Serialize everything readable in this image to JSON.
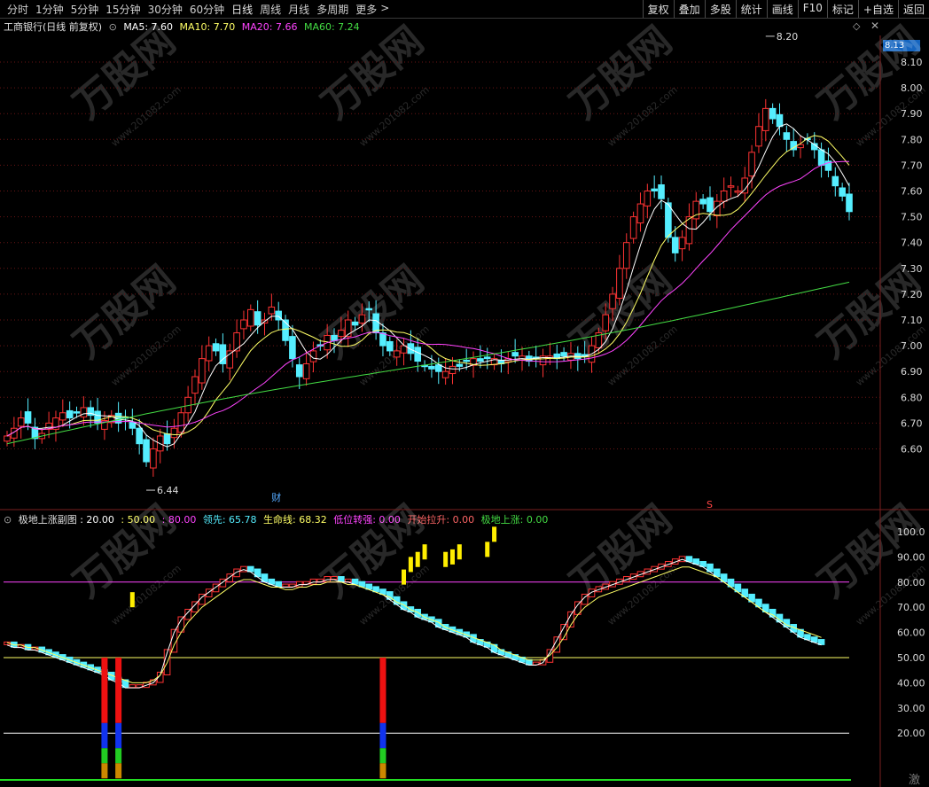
{
  "toolbar": {
    "periods": [
      "分时",
      "1分钟",
      "5分钟",
      "15分钟",
      "30分钟",
      "60分钟",
      "日线",
      "周线",
      "月线",
      "多周期",
      "更多"
    ],
    "active_period": "日线",
    "more_arrow": ">",
    "buttons": [
      "复权",
      "叠加",
      "多股",
      "统计",
      "画线",
      "F10",
      "标记",
      "+自选",
      "返回"
    ]
  },
  "main_legend": {
    "title": "工商银行(日线 前复权)",
    "ma5": "MA5: 7.60",
    "ma10": "MA10: 7.70",
    "ma20": "MA20: 7.66",
    "ma60": "MA60: 7.24"
  },
  "sub_legend": {
    "title": "极地上涨副图",
    "v1": ": 20.00",
    "v2": ": 50.00",
    "v3": ": 80.00",
    "lead": "领先: 65.78",
    "life": "生命线: 68.32",
    "low": "低位转强: 0.00",
    "start": "开始拉升: 0.00",
    "rise": "极地上涨: 0.00"
  },
  "colors": {
    "ma5": "#ffffff",
    "ma10": "#ffff66",
    "ma20": "#ff44ff",
    "ma60": "#44dd44",
    "up": "#ff3333",
    "down": "#55eeff"
  },
  "markers": {
    "high_label": "8.20",
    "low_label": "6.44",
    "last_price": "8.13",
    "event_cai": "财",
    "event_s": "S",
    "watermark": "万股网",
    "watermark_url": "www.201082.com",
    "corner_text": "激"
  },
  "chart_data": [
    {
      "type": "candlestick",
      "title": "工商银行(日线 前复权)",
      "ylim": [
        6.44,
        8.2
      ],
      "yticks": [
        "8.10",
        "8.00",
        "7.90",
        "7.80",
        "7.70",
        "7.60",
        "7.50",
        "7.40",
        "7.30",
        "7.20",
        "7.10",
        "7.00",
        "6.90",
        "6.80",
        "6.70",
        "6.60"
      ],
      "close": [
        6.65,
        6.68,
        6.72,
        6.7,
        6.64,
        6.66,
        6.7,
        6.72,
        6.74,
        6.72,
        6.74,
        6.76,
        6.73,
        6.7,
        6.71,
        6.73,
        6.7,
        6.72,
        6.68,
        6.62,
        6.55,
        6.6,
        6.65,
        6.62,
        6.68,
        6.74,
        6.8,
        6.88,
        6.95,
        7.0,
        6.98,
        6.93,
        6.98,
        7.05,
        7.1,
        7.14,
        7.08,
        7.1,
        7.15,
        7.1,
        7.02,
        6.95,
        6.88,
        6.93,
        6.98,
        7.0,
        7.04,
        7.02,
        7.06,
        7.1,
        7.08,
        7.12,
        7.14,
        7.05,
        7.0,
        6.98,
        6.98,
        7.0,
        6.97,
        6.94,
        6.92,
        6.91,
        6.9,
        6.9,
        6.92,
        6.92,
        6.94,
        6.95,
        6.94,
        6.95,
        6.95,
        6.93,
        6.95,
        6.96,
        6.96,
        6.94,
        6.95,
        6.96,
        6.96,
        6.95,
        6.96,
        6.97,
        6.95,
        6.96,
        7.0,
        7.05,
        7.12,
        7.2,
        7.3,
        7.4,
        7.5,
        7.55,
        7.6,
        7.6,
        7.57,
        7.42,
        7.36,
        7.42,
        7.5,
        7.56,
        7.55,
        7.52,
        7.56,
        7.6,
        7.62,
        7.6,
        7.65,
        7.75,
        7.85,
        7.92,
        7.88,
        7.85,
        7.8,
        7.76,
        7.78,
        7.8,
        7.76,
        7.7,
        7.68,
        7.62,
        7.58,
        7.52
      ],
      "ma_last": {
        "ma5": 7.6,
        "ma10": 7.7,
        "ma20": 7.66,
        "ma60": 7.24
      }
    },
    {
      "type": "indicator",
      "title": "极地上涨副图",
      "ylim": [
        0,
        100
      ],
      "yticks": [
        "100.0",
        "90.00",
        "80.00",
        "70.00",
        "60.00",
        "50.00",
        "40.00",
        "30.00",
        "20.00"
      ],
      "hlines": [
        20,
        50,
        80
      ],
      "lead": [
        55,
        54,
        54,
        53,
        53,
        52,
        51,
        50,
        49,
        48,
        47,
        46,
        45,
        44,
        43,
        41,
        40,
        38,
        38,
        38,
        39,
        40,
        43,
        52,
        60,
        65,
        68,
        71,
        74,
        76,
        78,
        80,
        82,
        84,
        85,
        84,
        82,
        80,
        79,
        78,
        78,
        78,
        79,
        79,
        80,
        80,
        81,
        81,
        80,
        80,
        79,
        78,
        77,
        76,
        75,
        73,
        71,
        69,
        68,
        66,
        65,
        64,
        62,
        61,
        60,
        59,
        58,
        56,
        55,
        54,
        52,
        51,
        50,
        49,
        48,
        47,
        47,
        48,
        52,
        57,
        62,
        67,
        71,
        74,
        76,
        77,
        78,
        79,
        80,
        81,
        82,
        83,
        84,
        85,
        86,
        87,
        88,
        89,
        88,
        87,
        86,
        84,
        82,
        80,
        78,
        76,
        74,
        72,
        70,
        68,
        66,
        64,
        62,
        60,
        58,
        57,
        56,
        55
      ],
      "life": [
        56,
        55,
        55,
        54,
        54,
        53,
        52,
        51,
        50,
        49,
        48,
        47,
        46,
        45,
        44,
        43,
        42,
        41,
        40,
        40,
        40,
        41,
        43,
        48,
        55,
        60,
        64,
        67,
        70,
        72,
        74,
        76,
        78,
        80,
        81,
        81,
        80,
        79,
        78,
        78,
        77,
        77,
        78,
        78,
        79,
        79,
        80,
        80,
        80,
        79,
        79,
        78,
        77,
        76,
        75,
        74,
        72,
        71,
        69,
        68,
        66,
        65,
        64,
        62,
        61,
        60,
        59,
        58,
        57,
        56,
        55,
        53,
        52,
        51,
        50,
        49,
        49,
        49,
        51,
        54,
        58,
        63,
        67,
        70,
        72,
        74,
        75,
        76,
        77,
        78,
        79,
        80,
        81,
        82,
        83,
        84,
        85,
        86,
        86,
        85,
        84,
        83,
        82,
        80,
        78,
        76,
        74,
        72,
        70,
        68,
        67,
        65,
        63,
        62,
        61,
        60,
        59,
        58
      ]
    }
  ]
}
